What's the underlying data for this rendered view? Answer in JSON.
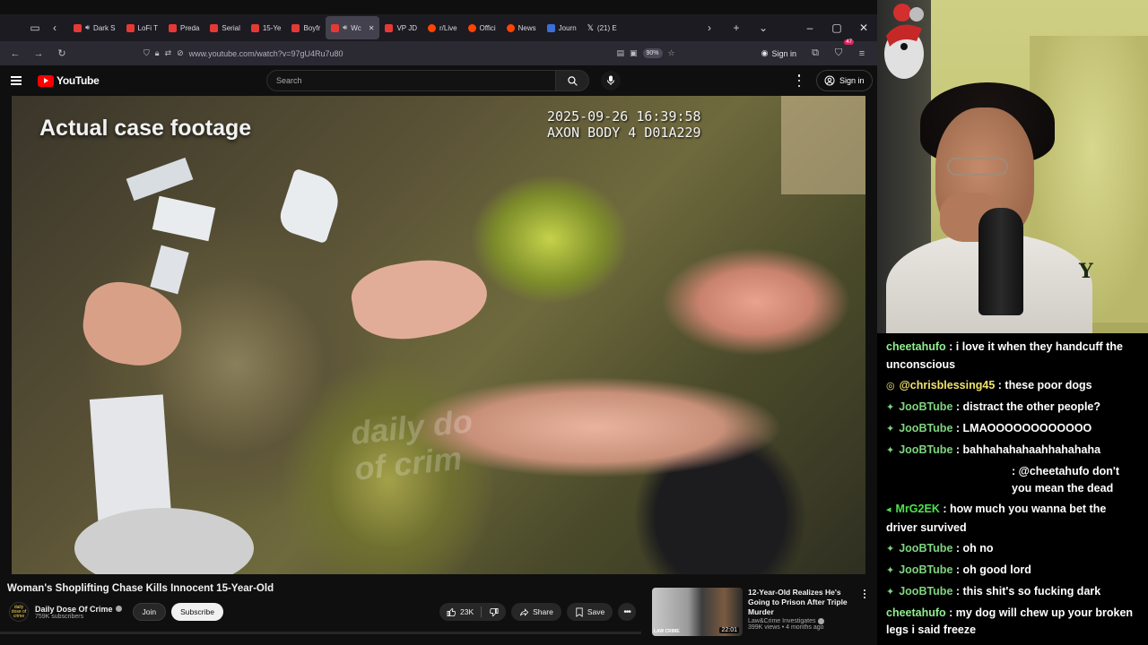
{
  "browser": {
    "tabs": [
      {
        "label": "Dark S",
        "kind": "yt",
        "sound": true,
        "active": false
      },
      {
        "label": "LoFi T",
        "kind": "yt",
        "sound": false,
        "active": false
      },
      {
        "label": "Preda",
        "kind": "yt",
        "sound": false,
        "active": false
      },
      {
        "label": "Serial",
        "kind": "yt",
        "sound": false,
        "active": false
      },
      {
        "label": "15-Ye",
        "kind": "yt",
        "sound": false,
        "active": false
      },
      {
        "label": "Boyfr",
        "kind": "yt",
        "sound": false,
        "active": false
      },
      {
        "label": "Wc",
        "kind": "yt",
        "sound": true,
        "active": true
      },
      {
        "label": "VP JD",
        "kind": "yt",
        "sound": false,
        "active": false
      },
      {
        "label": "r/Live",
        "kind": "reddit",
        "sound": false,
        "active": false
      },
      {
        "label": "Offici",
        "kind": "reddit",
        "sound": false,
        "active": false
      },
      {
        "label": "News",
        "kind": "reddit",
        "sound": false,
        "active": false
      },
      {
        "label": "Journ",
        "kind": "ghost",
        "sound": false,
        "active": false
      },
      {
        "label": "(21) E",
        "kind": "x",
        "sound": false,
        "active": false
      }
    ],
    "url": "www.youtube.com/watch?v=97gU4Ru7u80",
    "zoom": "90%",
    "sign_in": "Sign in",
    "ext_badge": "47"
  },
  "youtube": {
    "logo": "YouTube",
    "search_placeholder": "Search",
    "sign_in": "Sign in"
  },
  "video": {
    "caption": "Actual case footage",
    "timestamp_line1": "2025-09-26 16:39:58",
    "timestamp_line2": "AXON BODY 4 D01A229",
    "watermark_line1": "daily do",
    "watermark_line2": "of crim",
    "title": "Woman's Shoplifting Chase Kills Innocent 15-Year-Old"
  },
  "channel": {
    "name": "Daily Dose Of Crime",
    "subscribers": "759K subscribers",
    "join": "Join",
    "subscribe": "Subscribe",
    "avatar_text": "daily dose of crime"
  },
  "actions": {
    "likes": "23K",
    "share": "Share",
    "save": "Save"
  },
  "recommended": {
    "title": "12-Year-Old Realizes He's Going to Prison After Triple Murder",
    "channel": "Law&Crime Investigates",
    "meta": "399K views • 4 months ago",
    "duration": "22:01",
    "thumb_logo": "LAW CRIME"
  },
  "webcam": {
    "flag_letter": "Y"
  },
  "chat": [
    {
      "user": "cheetahufo",
      "text": "i love it when they handcuff the unconscious",
      "color": "green",
      "icon": ""
    },
    {
      "user": "@chrisblessing45",
      "text": "these poor dogs",
      "color": "yellowish",
      "icon": "◎"
    },
    {
      "user": "JooBTube",
      "text": "distract the other people?",
      "color": "mint",
      "icon": "✦"
    },
    {
      "user": "JooBTube",
      "text": "LMAOOOOOOOOOOOO",
      "color": "mint",
      "icon": "✦"
    },
    {
      "user": "JooBTube",
      "text": "bahhahahahaahhahahaha",
      "color": "mint",
      "icon": "✦"
    },
    {
      "user": "",
      "text": "@cheetahufo don't you mean the dead",
      "color": "mint",
      "icon": "",
      "indent": true
    },
    {
      "user": "MrG2EK",
      "text": "how much you wanna bet the driver survived",
      "color": "lime",
      "icon": "◂"
    },
    {
      "user": "JooBTube",
      "text": "oh no",
      "color": "mint",
      "icon": "✦"
    },
    {
      "user": "JooBTube",
      "text": "oh good lord",
      "color": "mint",
      "icon": "✦"
    },
    {
      "user": "JooBTube",
      "text": "this shit's so fucking dark",
      "color": "mint",
      "icon": "✦"
    },
    {
      "user": "cheetahufo",
      "text": "my dog will chew up your broken legs i said freeze",
      "color": "green",
      "icon": ""
    }
  ]
}
